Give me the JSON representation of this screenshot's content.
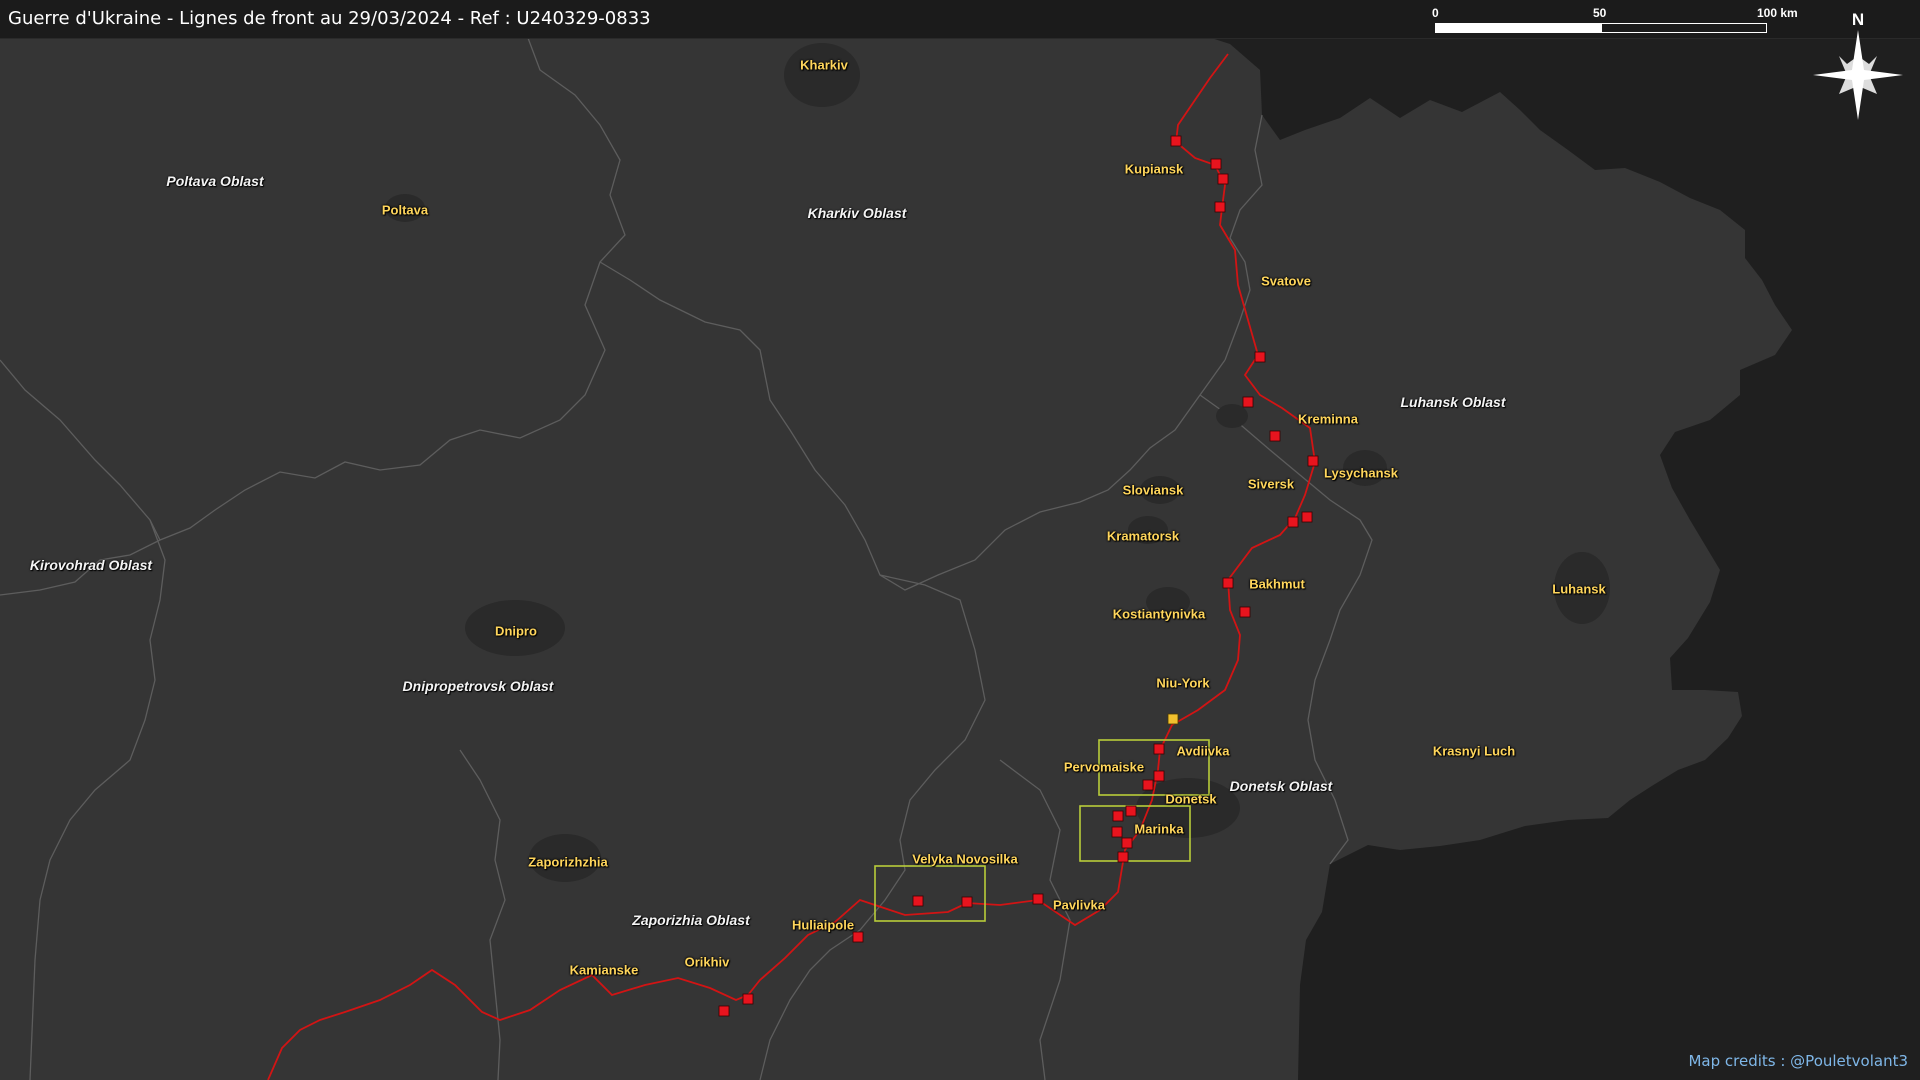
{
  "title": "Guerre d'Ukraine - Lignes de front au 29/03/2024 - Ref : U240329-0833",
  "credits": "Map credits : @Pouletvolant3",
  "north_label": "N",
  "scale": {
    "labels": [
      "0",
      "50",
      "100 km"
    ]
  },
  "colors": {
    "territory": "#353535",
    "outside": "#1f1f1f",
    "front_line": "#d21414",
    "marker": "#e8141e",
    "marker_highlight": "#f2c12e",
    "zone_box": "#b8cc3a",
    "city_label": "#ffd65c",
    "oblast_label": "#f4f4f4",
    "credits": "#7fb7e8"
  },
  "oblasts": [
    {
      "name": "Poltava Oblast"
    },
    {
      "name": "Kharkiv Oblast"
    },
    {
      "name": "Luhansk Oblast"
    },
    {
      "name": "Kirovohrad Oblast"
    },
    {
      "name": "Dnipropetrovsk Oblast"
    },
    {
      "name": "Donetsk Oblast"
    },
    {
      "name": "Zaporizhia Oblast"
    }
  ],
  "cities": [
    {
      "name": "Kharkiv"
    },
    {
      "name": "Poltava"
    },
    {
      "name": "Kupiansk"
    },
    {
      "name": "Svatove"
    },
    {
      "name": "Kreminna"
    },
    {
      "name": "Lysychansk"
    },
    {
      "name": "Siversk"
    },
    {
      "name": "Sloviansk"
    },
    {
      "name": "Kramatorsk"
    },
    {
      "name": "Bakhmut"
    },
    {
      "name": "Kostiantynivka"
    },
    {
      "name": "Luhansk"
    },
    {
      "name": "Dnipro"
    },
    {
      "name": "Niu-York"
    },
    {
      "name": "Avdiivka"
    },
    {
      "name": "Pervomaiske"
    },
    {
      "name": "Donetsk"
    },
    {
      "name": "Krasnyi Luch"
    },
    {
      "name": "Marinka"
    },
    {
      "name": "Zaporizhzhia"
    },
    {
      "name": "Velyka Novosilka"
    },
    {
      "name": "Pavlivka"
    },
    {
      "name": "Huliaipole"
    },
    {
      "name": "Orikhiv"
    },
    {
      "name": "Kamianske"
    }
  ]
}
